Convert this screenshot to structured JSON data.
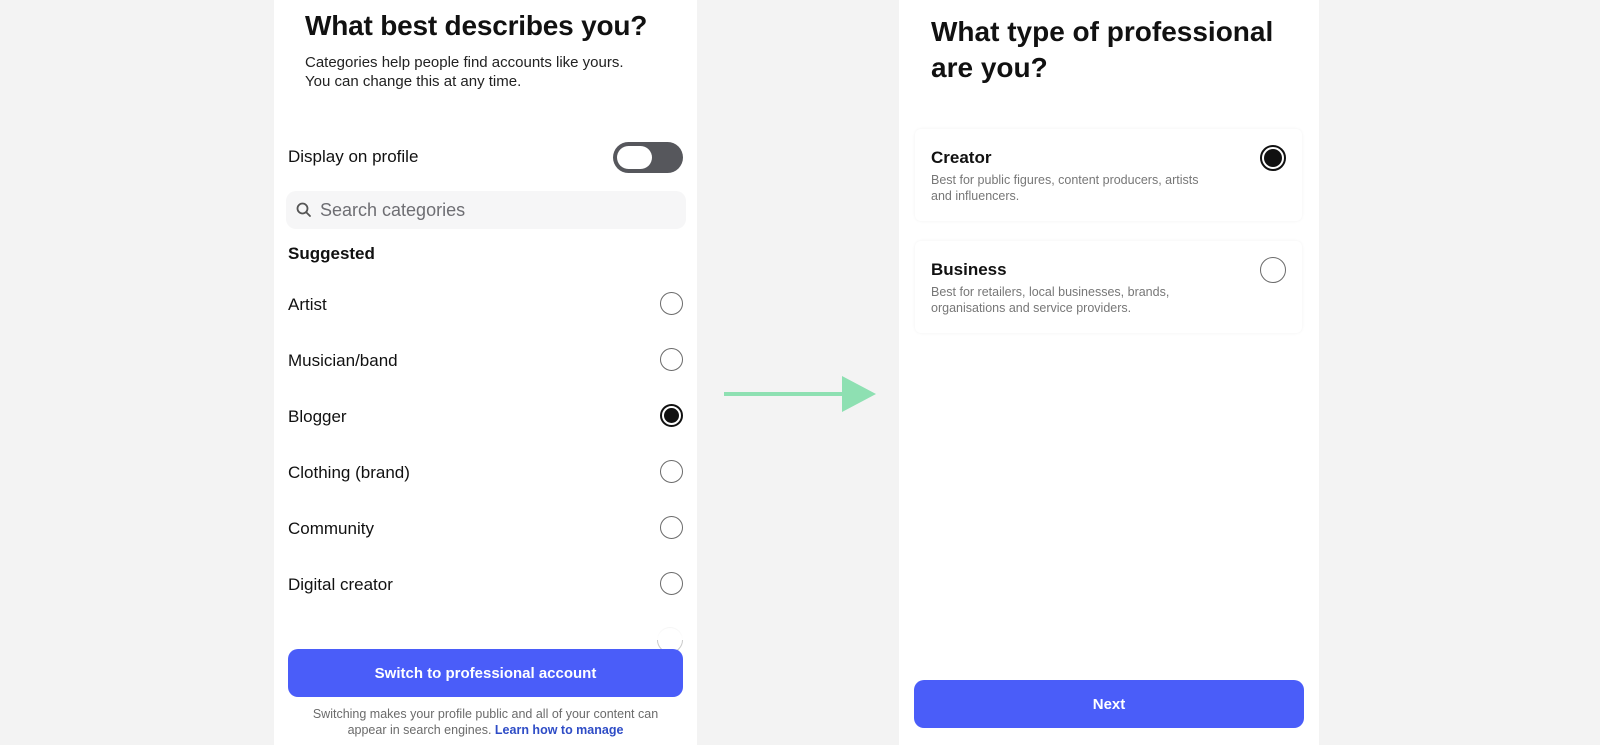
{
  "colors": {
    "background": "#f3f3f3",
    "primary_button": "#4a5df9",
    "arrow": "#8ee0b2",
    "toggle_track": "#56575c",
    "link": "#2e4cc6"
  },
  "left_screen": {
    "title": "What best describes you?",
    "subtitle_lines": [
      "Categories help people find accounts like yours.",
      "You can change this at any time."
    ],
    "display_on_profile": {
      "label": "Display on profile",
      "enabled": false
    },
    "search": {
      "placeholder": "Search categories",
      "value": "",
      "icon": "search-icon"
    },
    "suggested_heading": "Suggested",
    "categories": [
      {
        "label": "Artist",
        "selected": false
      },
      {
        "label": "Musician/band",
        "selected": false
      },
      {
        "label": "Blogger",
        "selected": true
      },
      {
        "label": "Clothing (brand)",
        "selected": false
      },
      {
        "label": "Community",
        "selected": false
      },
      {
        "label": "Digital creator",
        "selected": false
      }
    ],
    "switch_button_label": "Switch to professional account",
    "footnote_line1": "Switching makes your profile public and all of your content can",
    "footnote_line2": "appear in search engines.",
    "learn_link": "Learn how to manage"
  },
  "arrow_icon": "right-arrow-icon",
  "right_screen": {
    "title_lines": [
      "What type of professional",
      "are you?"
    ],
    "options": [
      {
        "title": "Creator",
        "description_lines": [
          "Best for public figures, content producers, artists",
          "and influencers."
        ],
        "selected": true
      },
      {
        "title": "Business",
        "description_lines": [
          "Best for retailers, local businesses, brands,",
          "organisations and service providers."
        ],
        "selected": false
      }
    ],
    "next_button_label": "Next"
  }
}
